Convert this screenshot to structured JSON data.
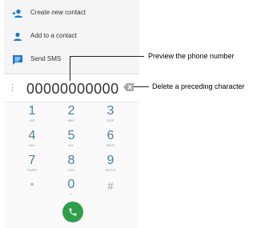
{
  "menu": {
    "items": [
      {
        "label": "Create new contact",
        "icon": "add-person-icon"
      },
      {
        "label": "Add to a contact",
        "icon": "person-icon"
      },
      {
        "label": "Send SMS",
        "icon": "message-icon"
      }
    ]
  },
  "dialer": {
    "number": "00000000000",
    "keys": [
      {
        "digit": "1",
        "letters": "GO"
      },
      {
        "digit": "2",
        "letters": "ABC"
      },
      {
        "digit": "3",
        "letters": "DEF"
      },
      {
        "digit": "4",
        "letters": "GHI"
      },
      {
        "digit": "5",
        "letters": "JKL"
      },
      {
        "digit": "6",
        "letters": "MNO"
      },
      {
        "digit": "7",
        "letters": "PQRS"
      },
      {
        "digit": "8",
        "letters": "TUV"
      },
      {
        "digit": "9",
        "letters": "WXYZ"
      },
      {
        "digit": "*",
        "letters": ""
      },
      {
        "digit": "0",
        "letters": "+"
      },
      {
        "digit": "#",
        "letters": ""
      }
    ]
  },
  "callouts": {
    "preview": "Preview the phone number",
    "delete": "Delete a preceding character"
  },
  "colors": {
    "accent": "#4a7fa7",
    "call": "#2e9e48",
    "icon": "#1976d2"
  }
}
